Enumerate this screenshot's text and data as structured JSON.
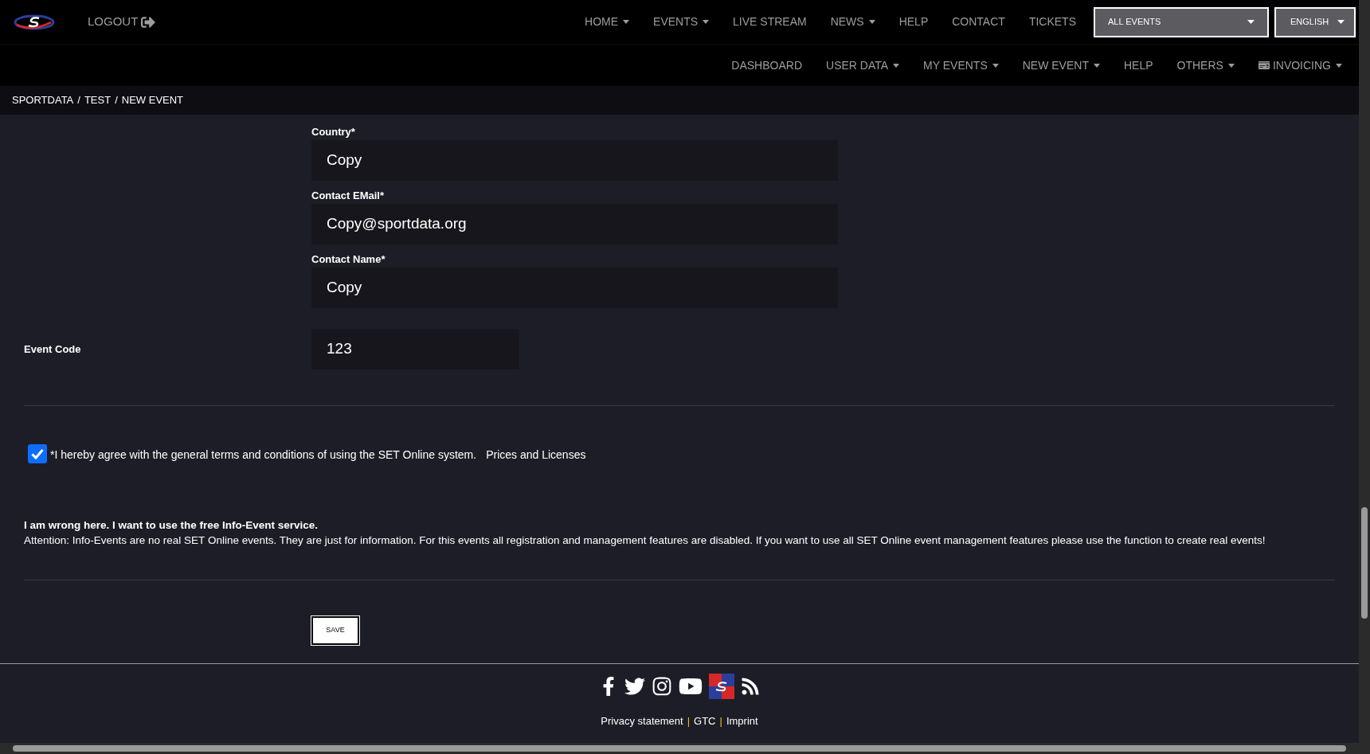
{
  "header": {
    "logout": "LOGOUT",
    "nav": [
      {
        "label": "HOME",
        "dropdown": true
      },
      {
        "label": "EVENTS",
        "dropdown": true
      },
      {
        "label": "LIVE STREAM",
        "dropdown": false
      },
      {
        "label": "NEWS",
        "dropdown": true
      },
      {
        "label": "HELP",
        "dropdown": false
      },
      {
        "label": "CONTACT",
        "dropdown": false
      },
      {
        "label": "TICKETS",
        "dropdown": false
      }
    ],
    "event_select": "ALL EVENTS",
    "language_select": "ENGLISH"
  },
  "subnav": [
    {
      "label": "DASHBOARD",
      "dropdown": false,
      "icon": false
    },
    {
      "label": "USER DATA",
      "dropdown": true,
      "icon": false
    },
    {
      "label": "MY EVENTS",
      "dropdown": true,
      "icon": false
    },
    {
      "label": "NEW EVENT",
      "dropdown": true,
      "icon": false
    },
    {
      "label": "HELP",
      "dropdown": false,
      "icon": false
    },
    {
      "label": "OTHERS",
      "dropdown": true,
      "icon": false
    },
    {
      "label": "INVOICING",
      "dropdown": true,
      "icon": true
    }
  ],
  "breadcrumb": {
    "separator": "/",
    "items": [
      "SPORTDATA",
      "TEST",
      "NEW EVENT"
    ]
  },
  "fields": [
    {
      "label": "Country*",
      "value": "Copy"
    },
    {
      "label": "Contact EMail*",
      "value": "Copy@sportdata.org"
    },
    {
      "label": "Contact Name*",
      "value": "Copy"
    }
  ],
  "event_code": {
    "label": "Event Code",
    "value": "123"
  },
  "terms": {
    "checked": true,
    "text": "*I hereby agree with the general terms and conditions of using the SET Online system.",
    "link": "Prices and Licenses"
  },
  "info": {
    "title": "I am wrong here. I want to use the free Info-Event service.",
    "text": "Attention: Info-Events are no real SET Online events. They are just for information. For this events all registration and management features are disabled. If you want to use all SET Online event management features please use the function to create real events!"
  },
  "save": "SAVE",
  "footer": {
    "separator": "|",
    "links": [
      "Privacy statement",
      "GTC",
      "Imprint"
    ]
  }
}
